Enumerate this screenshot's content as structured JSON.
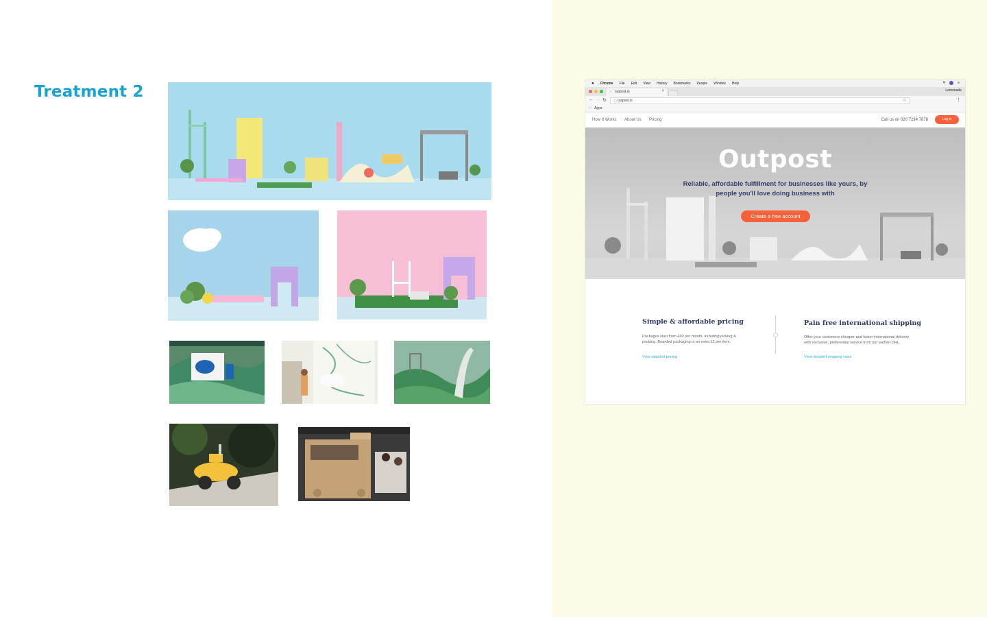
{
  "slide": {
    "title": "Treatment 2"
  },
  "photos": [
    {
      "name": "panorama-set"
    },
    {
      "name": "cloud-arch-scene"
    },
    {
      "name": "pink-rugby-scene"
    },
    {
      "name": "cravendale-truck"
    },
    {
      "name": "cravendale-map"
    },
    {
      "name": "green-hills-ramp"
    },
    {
      "name": "yellow-scooter"
    },
    {
      "name": "cardboard-van"
    }
  ],
  "browser": {
    "menubar": {
      "app": "Chrome",
      "items": [
        "File",
        "Edit",
        "View",
        "History",
        "Bookmarks",
        "People",
        "Window",
        "Help"
      ],
      "user": "Lemonade"
    },
    "tab_title": "outpost.io",
    "url": "outpost.io",
    "bookmarks_label": "Apps"
  },
  "site": {
    "nav": [
      "How It Works",
      "About Us",
      "Pricing"
    ],
    "phone": "Call us on 020 7234 7878",
    "login": "Log in",
    "hero_title": "Outpost",
    "hero_subtitle": "Reliable, affordable fulfillment for businesses like yours, by people you'll love doing business with",
    "cta": "Create a free account",
    "features": [
      {
        "title": "Simple & affordable pricing",
        "text": "Packages start from £60 per month, including picking & packing. Branded packaging is an extra £2 per item.",
        "link": "View detailed pricing"
      },
      {
        "title": "Pain free international shipping",
        "text": "Offer your customers cheaper and faster international delivery with exclusive, preferential service from our partner DHL.",
        "link": "View detailed shipping rates"
      }
    ]
  },
  "colors": {
    "title_blue": "#1aa3d1",
    "right_panel_bg": "#fbfbe6",
    "accent_orange": "#f4613a",
    "navy": "#2f3768",
    "link_blue": "#2eb3d6"
  }
}
